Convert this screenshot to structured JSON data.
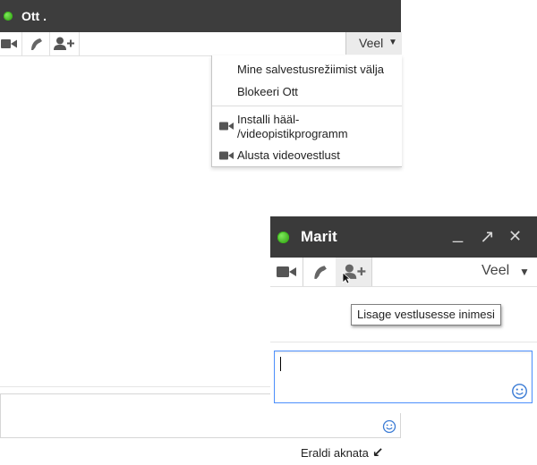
{
  "chat_back": {
    "title": "Ott .",
    "status_color": "#3cb81b",
    "toolbar": {
      "video_icon": "video-camera-icon",
      "call_icon": "phone-handset-icon",
      "add_icon": "add-person-icon",
      "more_label": "Veel",
      "more_arrow": "▼"
    },
    "menu": {
      "items": [
        "Mine salvestusrežiimist välja",
        "Blokeeri Ott",
        "Installi hääl-\n/videopistikprogramm",
        "Alusta videovestlust"
      ]
    },
    "popout": {
      "label": "Eraldi aknata",
      "arrow": "↙"
    }
  },
  "chat_front": {
    "title": "Marit",
    "status_color": "#3cb81b",
    "controls": {
      "minimize": "_",
      "popout": "↗",
      "close": "✕"
    },
    "toolbar": {
      "more_label": "Veel",
      "more_arrow": "▼"
    },
    "tooltip": "Lisage vestlusesse inimesi"
  }
}
